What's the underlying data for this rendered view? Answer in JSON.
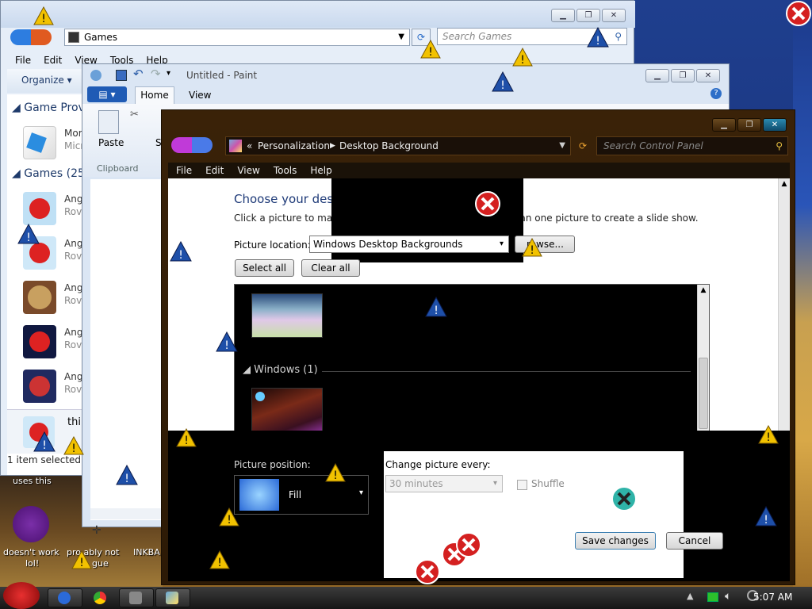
{
  "games_window": {
    "address": "Games",
    "search_placeholder": "Search Games",
    "menu": [
      "File",
      "Edit",
      "View",
      "Tools",
      "Help"
    ],
    "organize_label": "Organize",
    "section_provider": "Game Prov",
    "provider_item_name": "Mor",
    "provider_item_sub": "Micr",
    "section_games": "Games (25)",
    "games": [
      {
        "name": "Ang",
        "sub": "Rovi"
      },
      {
        "name": "Ang",
        "sub": "Rovi"
      },
      {
        "name": "Ang",
        "sub": "Rovi"
      },
      {
        "name": "Ang",
        "sub": "Rovi"
      },
      {
        "name": "Ang",
        "sub": "Rovi"
      }
    ],
    "details_name": "thi",
    "status": "1 item selected"
  },
  "paint_window": {
    "title": "Untitled - Paint",
    "tabs": [
      "Home",
      "View"
    ],
    "paste_label": "Paste",
    "clipboard_label": "Clipboard",
    "s_label": "S"
  },
  "cp_window": {
    "breadcrumb_prefix": "«",
    "breadcrumb": [
      "Personalization",
      "Desktop Background"
    ],
    "search_placeholder": "Search Control Panel",
    "menu": [
      "File",
      "Edit",
      "View",
      "Tools",
      "Help"
    ],
    "heading": "Choose your desktop background",
    "instruction_left": "Click a picture to make it your desktop background, or se",
    "instruction_right": "e than one picture to create a slide show.",
    "picture_location_label": "Picture location:",
    "picture_location_value": "Windows Desktop Backgrounds",
    "browse_label": "rowse...",
    "select_all": "Select all",
    "clear_all": "Clear all",
    "group_windows": "Windows (1)",
    "picture_position_label": "Picture position:",
    "picture_position_value": "Fill",
    "change_every_label": "Change picture every:",
    "change_every_value": "30 minutes",
    "shuffle_label": "Shuffle",
    "save_changes": "Save changes",
    "cancel": "Cancel"
  },
  "desktop": {
    "label_uses_this": "uses this",
    "label_doesnt_work": "doesn't work",
    "label_lol": "lol!",
    "label_probably": "pro  ably not",
    "label_gue": "gue",
    "label_inkba": "INKBA"
  },
  "taskbar": {
    "clock": "5:07 AM"
  },
  "colors": {
    "cp_frame": "#3a2208",
    "accent_blue": "#1e4fa8",
    "warning_yellow": "#f2c200",
    "error_red": "#d42020"
  }
}
